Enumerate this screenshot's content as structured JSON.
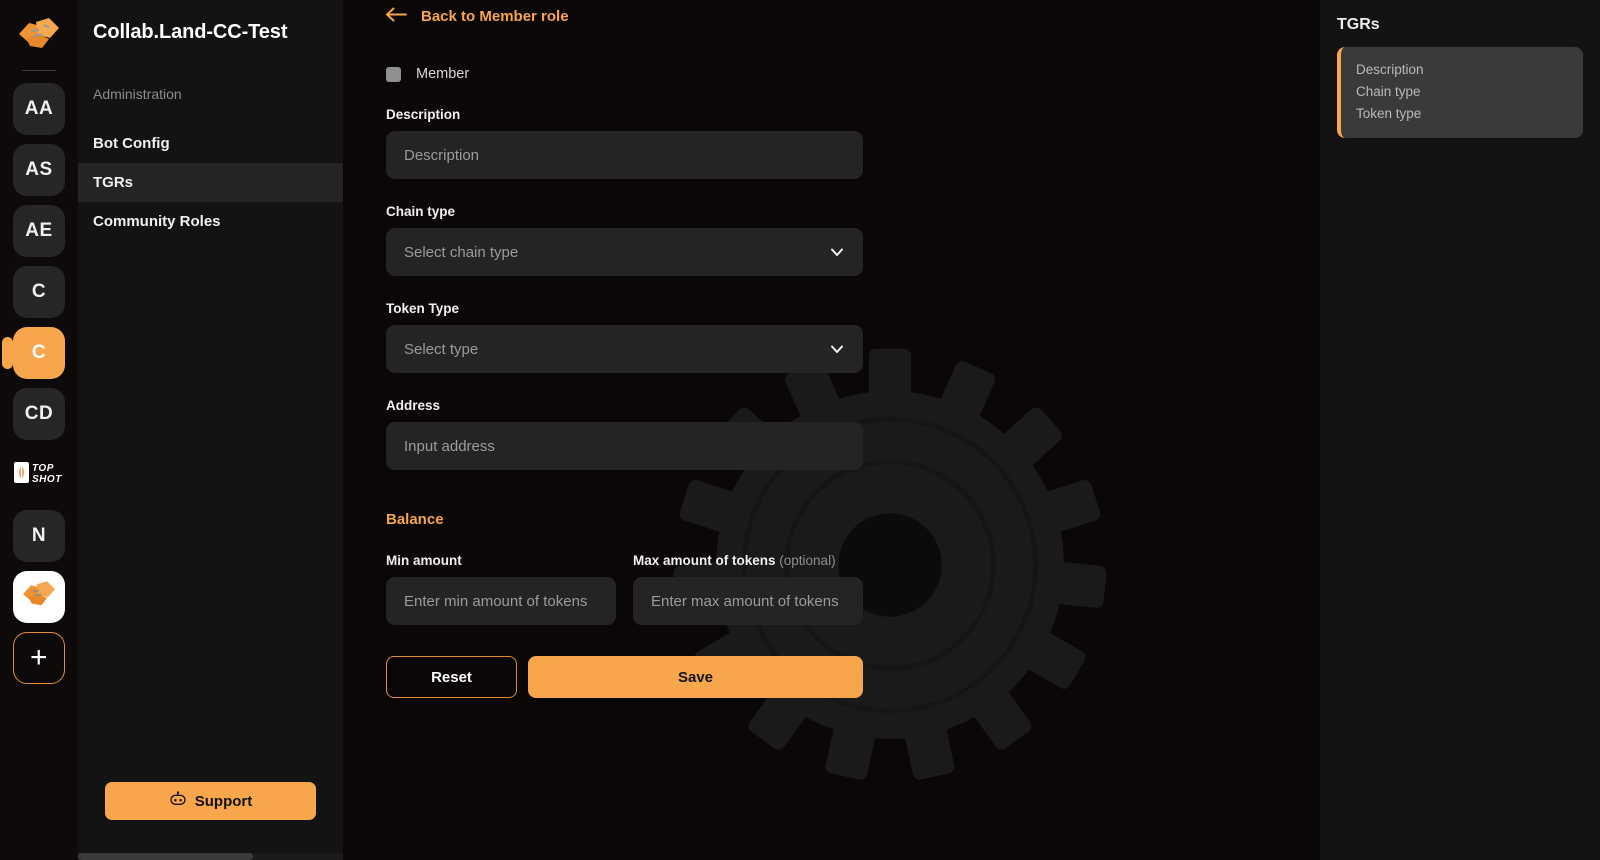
{
  "rail": {
    "logo_icon": "collabland-handshake-logo",
    "items": [
      {
        "label": "AA",
        "kind": "initials",
        "active": false
      },
      {
        "label": "AS",
        "kind": "initials",
        "active": false
      },
      {
        "label": "AE",
        "kind": "initials",
        "active": false
      },
      {
        "label": "C",
        "kind": "initials",
        "active": false
      },
      {
        "label": "C",
        "kind": "initials",
        "active": true
      },
      {
        "label": "CD",
        "kind": "initials",
        "active": false
      },
      {
        "label": "TOP SHOT",
        "kind": "image",
        "active": false
      },
      {
        "label": "N",
        "kind": "initials",
        "active": false
      },
      {
        "label": "",
        "kind": "image-light",
        "active": false
      }
    ],
    "add_label": "+"
  },
  "sidebar": {
    "community_title": "Collab.Land-CC-Test",
    "section_label": "Administration",
    "items": [
      {
        "label": "Bot Config",
        "active": false
      },
      {
        "label": "TGRs",
        "active": true
      },
      {
        "label": "Community Roles",
        "active": false
      }
    ],
    "support_label": "Support",
    "support_icon": "bot-icon"
  },
  "main": {
    "back_label": "Back to Member role",
    "back_icon": "arrow-left-icon",
    "role_name": "Member",
    "role_swatch_color": "#8f8f8f",
    "fields": {
      "description": {
        "label": "Description",
        "placeholder": "Description",
        "value": ""
      },
      "chain_type": {
        "label": "Chain type",
        "placeholder": "Select chain type",
        "value": "",
        "icon": "chevron-down-icon"
      },
      "token_type": {
        "label": "Token Type",
        "placeholder": "Select type",
        "value": "",
        "icon": "chevron-down-icon"
      },
      "address": {
        "label": "Address",
        "placeholder": "Input address",
        "value": ""
      },
      "min_amount": {
        "label": "Min amount",
        "placeholder": "Enter min amount of tokens",
        "value": ""
      },
      "max_amount": {
        "label": "Max amount of tokens",
        "label_suffix": "(optional)",
        "placeholder": "Enter max amount of tokens",
        "value": ""
      }
    },
    "balance_title": "Balance",
    "reset_label": "Reset",
    "save_label": "Save"
  },
  "right_panel": {
    "title": "TGRs",
    "links": [
      "Description",
      "Chain type",
      "Token type"
    ]
  },
  "colors": {
    "accent": "#f7a64b",
    "accent_border": "#e08c3a",
    "page_bg": "#0b0706",
    "panel_bg": "#131313",
    "input_bg": "#242424",
    "card_bg": "#3a3a3a"
  }
}
